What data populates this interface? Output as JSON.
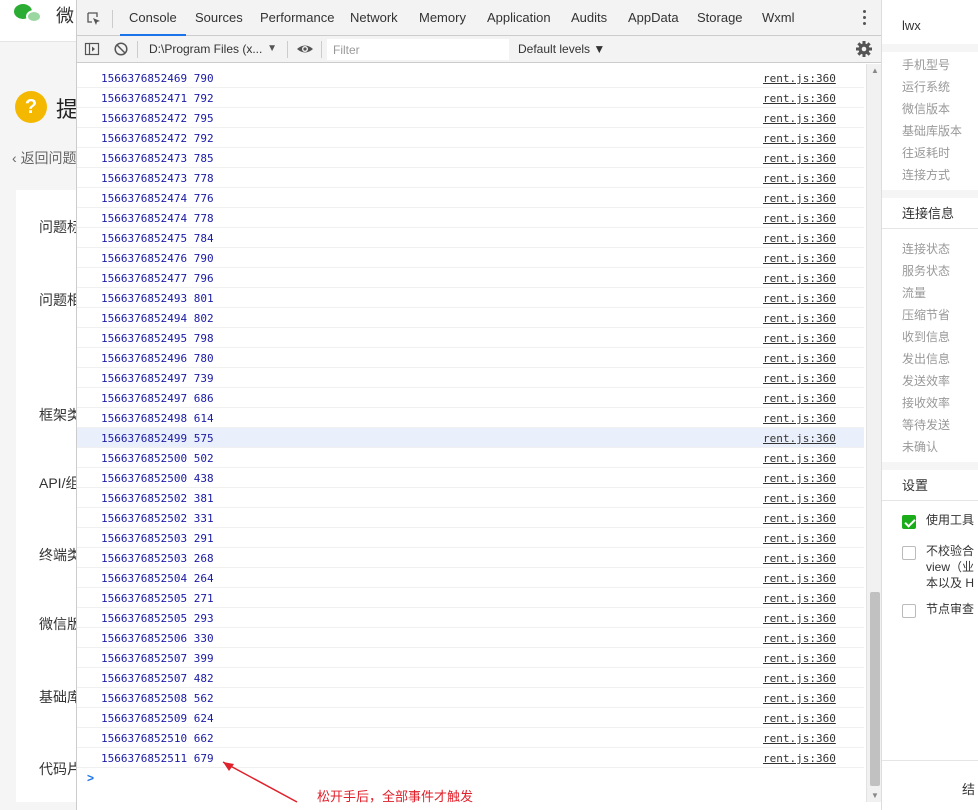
{
  "background": {
    "app_title": "微",
    "heading": "提",
    "back_link": "返回问题",
    "labels": [
      "问题标",
      "问题相",
      "框架类",
      "API/组",
      "终端类",
      "微信版",
      "基础库",
      "代码片"
    ]
  },
  "devtools": {
    "tabs": [
      "Console",
      "Sources",
      "Performance",
      "Network",
      "Memory",
      "Application",
      "Audits",
      "AppData",
      "Storage",
      "Wxml"
    ],
    "active_tab": "Console",
    "context": "D:\\Program Files (x...",
    "filter_placeholder": "Filter",
    "levels": "Default levels ▼"
  },
  "console": {
    "source": "rent.js:360",
    "prompt": ">",
    "highlighted_index": 18,
    "rows": [
      "1566376852469 790",
      "1566376852471 792",
      "1566376852472 795",
      "1566376852472 792",
      "1566376852473 785",
      "1566376852473 778",
      "1566376852474 776",
      "1566376852474 778",
      "1566376852475 784",
      "1566376852476 790",
      "1566376852477 796",
      "1566376852493 801",
      "1566376852494 802",
      "1566376852495 798",
      "1566376852496 780",
      "1566376852497 739",
      "1566376852497 686",
      "1566376852498 614",
      "1566376852499 575",
      "1566376852500 502",
      "1566376852500 438",
      "1566376852502 381",
      "1566376852502 331",
      "1566376852503 291",
      "1566376852503 268",
      "1566376852504 264",
      "1566376852505 271",
      "1566376852505 293",
      "1566376852506 330",
      "1566376852507 399",
      "1566376852507 482",
      "1566376852508 562",
      "1566376852509 624",
      "1566376852510 662",
      "1566376852511 679"
    ]
  },
  "annotation": "松开手后，全部事件才触发",
  "right_panel": {
    "title": "lwx",
    "device_items": [
      "手机型号",
      "运行系统",
      "微信版本",
      "基础库版本",
      "往返耗时",
      "连接方式"
    ],
    "connection_header": "连接信息",
    "connection_items": [
      "连接状态",
      "服务状态",
      "流量",
      "压缩节省",
      "收到信息",
      "发出信息",
      "发送效率",
      "接收效率",
      "等待发送",
      "未确认"
    ],
    "settings_header": "设置",
    "options": [
      {
        "text": "使用工具",
        "checked": true
      },
      {
        "text": "不校验合\nview（业\n本以及 H",
        "checked": false
      },
      {
        "text": "节点审查",
        "checked": false
      }
    ],
    "footer": "结"
  },
  "colors": {
    "tab_active_underline": "#1a73e8",
    "log_text": "#1a1aa6",
    "annotation": "#e0202a",
    "checkbox_on": "#1aad19"
  }
}
